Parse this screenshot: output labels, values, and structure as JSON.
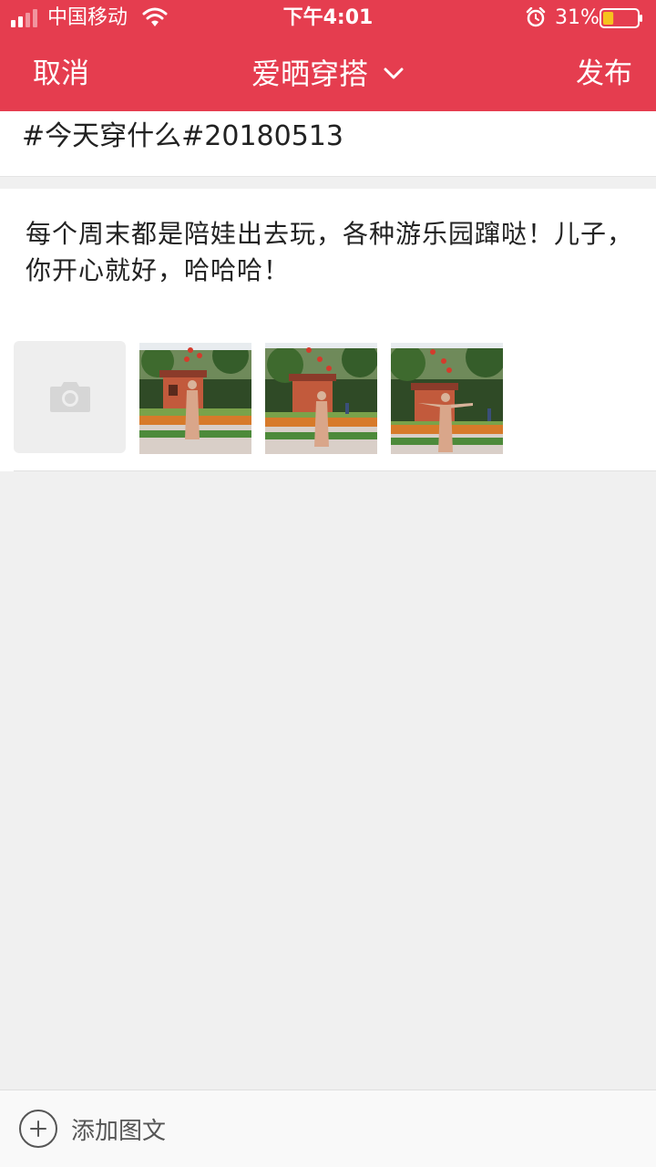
{
  "status_bar": {
    "carrier": "中国移动",
    "time": "下午4:01",
    "battery_percent": "31%",
    "battery_level": 0.31,
    "icons": [
      "signal-icon",
      "wifi-icon",
      "alarm-icon",
      "battery-icon"
    ]
  },
  "nav": {
    "cancel_label": "取消",
    "title": "爱晒穿搭",
    "publish_label": "发布",
    "title_icon": "chevron-down-icon"
  },
  "topic": {
    "value": "#今天穿什么#20180513"
  },
  "post": {
    "text": "每个周末都是陪娃出去玩，各种游乐园蹿哒！儿子，你开心就好，哈哈哈！",
    "add_photo_icon": "camera-icon",
    "photos": [
      "photo-1",
      "photo-2",
      "photo-3"
    ]
  },
  "toolbar": {
    "add_label": "添加图文",
    "add_icon": "plus-circle-icon"
  },
  "colors": {
    "accent": "#e53d4f",
    "background": "#f0f0f0",
    "text": "#222222"
  }
}
